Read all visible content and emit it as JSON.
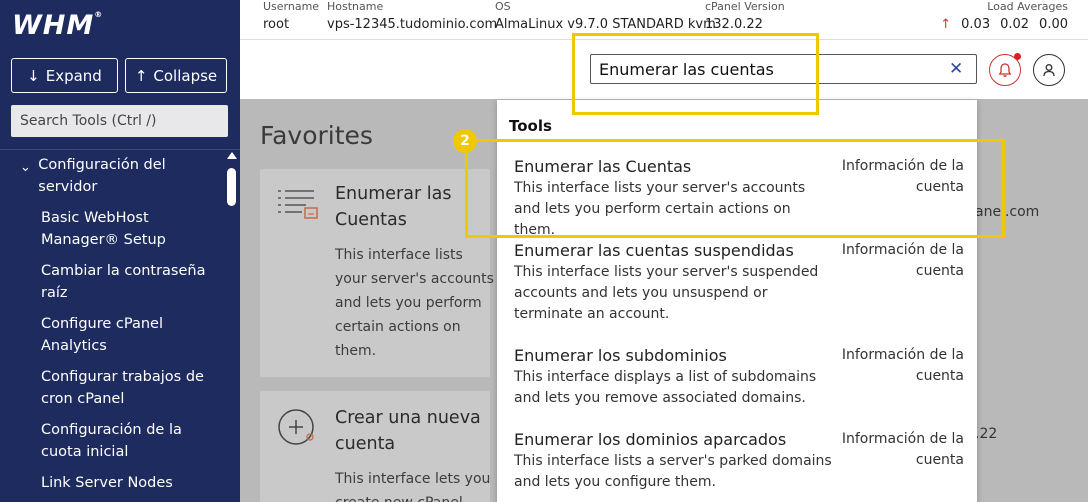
{
  "app": {
    "logo_text": "WHM",
    "logo_mark": "®"
  },
  "sidebar": {
    "expand_label": "Expand",
    "collapse_label": "Collapse",
    "search_placeholder": "Search Tools (Ctrl /)",
    "group_label": "Configuración del servidor",
    "items": [
      {
        "label": "Basic WebHost Manager® Setup"
      },
      {
        "label": "Cambiar la contraseña raíz"
      },
      {
        "label": "Configure cPanel Analytics"
      },
      {
        "label": "Configurar trabajos de cron cPanel"
      },
      {
        "label": "Configuración de la cuota inicial"
      },
      {
        "label": "Link Server Nodes"
      }
    ]
  },
  "infobar": {
    "username_label": "Username",
    "username": "root",
    "hostname_label": "Hostname",
    "hostname": "vps-12345.tudominio.com",
    "os_label": "OS",
    "os": "AlmaLinux v9.7.0 STANDARD kvm",
    "cpanel_label": "cPanel Version",
    "cpanel_version": "132.0.22",
    "load_label": "Load Averages",
    "load": [
      "0.03",
      "0.02",
      "0.00"
    ]
  },
  "search": {
    "value": "Enumerar las cuentas"
  },
  "main": {
    "favorites_title": "Favorites",
    "cards": [
      {
        "title": "Enumerar las Cuentas",
        "desc": "This interface lists your server's accounts and lets you perform certain actions on them."
      },
      {
        "title": "Crear una nueva cuenta",
        "desc": "This interface lets you create new cPanel"
      }
    ],
    "right_fragments": [
      "anel.com",
      ".22"
    ]
  },
  "dropdown": {
    "header": "Tools",
    "results": [
      {
        "title": "Enumerar las Cuentas",
        "desc": "This interface lists your server's accounts and lets you perform certain actions on them.",
        "category": "Información de la cuenta"
      },
      {
        "title": "Enumerar las cuentas suspendidas",
        "desc": "This interface lists your server's suspended accounts and lets you unsuspend or terminate an account.",
        "category": "Información de la cuenta"
      },
      {
        "title": "Enumerar los subdominios",
        "desc": "This interface displays a list of subdomains and lets you remove associated domains.",
        "category": "Información de la cuenta"
      },
      {
        "title": "Enumerar los dominios aparcados",
        "desc": "This interface lists a server's parked domains and lets you configure them.",
        "category": "Información de la cuenta"
      }
    ]
  },
  "annotation": {
    "step_number": "2",
    "highlight_color": "#f0c800"
  }
}
